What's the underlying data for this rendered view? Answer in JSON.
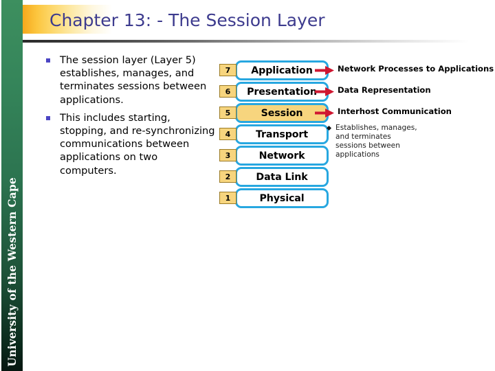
{
  "slide": {
    "title": "Chapter 13: - The Session Layer",
    "institution": "University of the Western Cape",
    "colors": {
      "title_text": "#3d3b8e",
      "sidebar_green": "#2c7450",
      "accent_yellow": "#f5a81c",
      "box_border_blue": "#27a7e0",
      "highlight_fill": "#f7d57e",
      "arrow_red": "#cf1731",
      "bullet_blue": "#4b45c4"
    }
  },
  "body": {
    "bullets": [
      "The session layer (Layer 5) establishes, manages, and terminates sessions between applications.",
      " This includes starting, stopping, and re-synchronizing communications between applications on two computers."
    ]
  },
  "osi_diagram": {
    "layers": [
      {
        "number": "7",
        "name": "Application",
        "note": "Network Processes to Applications",
        "highlighted": false,
        "has_arrow": true
      },
      {
        "number": "6",
        "name": "Presentation",
        "note": "Data Representation",
        "highlighted": false,
        "has_arrow": true
      },
      {
        "number": "5",
        "name": "Session",
        "note": "Interhost Communication",
        "highlighted": true,
        "has_arrow": true
      },
      {
        "number": "4",
        "name": "Transport",
        "note": "",
        "highlighted": false,
        "has_arrow": false
      },
      {
        "number": "3",
        "name": "Network",
        "note": "",
        "highlighted": false,
        "has_arrow": false
      },
      {
        "number": "2",
        "name": "Data Link",
        "note": "",
        "highlighted": false,
        "has_arrow": false
      },
      {
        "number": "1",
        "name": "Physical",
        "note": "",
        "highlighted": false,
        "has_arrow": false
      }
    ],
    "sub_note": "Establishes, manages, and terminates sessions between applications"
  }
}
